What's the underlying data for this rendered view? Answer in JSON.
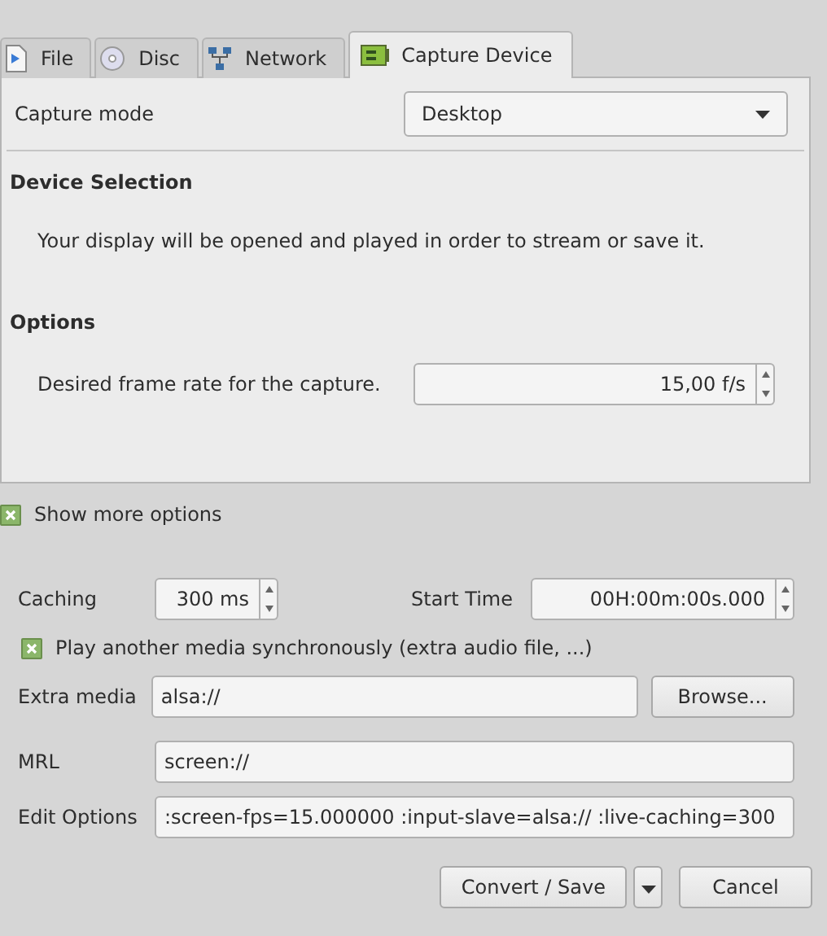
{
  "tabs": [
    {
      "label": "File",
      "selected": false
    },
    {
      "label": "Disc",
      "selected": false
    },
    {
      "label": "Network",
      "selected": false
    },
    {
      "label": "Capture Device",
      "selected": true
    }
  ],
  "capture_mode": {
    "label": "Capture mode",
    "value": "Desktop"
  },
  "device_selection": {
    "heading": "Device Selection",
    "text": "Your display will be opened and played in order to stream or save it."
  },
  "options": {
    "heading": "Options",
    "frame_rate_label": "Desired frame rate for the capture.",
    "frame_rate_value": "15,00 f/s"
  },
  "show_more_options": {
    "label": "Show more options",
    "checked": true
  },
  "caching": {
    "label": "Caching",
    "value": "300 ms"
  },
  "start_time": {
    "label": "Start Time",
    "value": "00H:00m:00s.000"
  },
  "play_another": {
    "label": "Play another media synchronously (extra audio file, ...)",
    "checked": true
  },
  "extra_media": {
    "label": "Extra media",
    "value": "alsa://",
    "button": "Browse..."
  },
  "mrl": {
    "label": "MRL",
    "value": "screen://"
  },
  "edit_options": {
    "label": "Edit Options",
    "value": ":screen-fps=15.000000 :input-slave=alsa:// :live-caching=300"
  },
  "buttons": {
    "primary": "Convert / Save",
    "cancel": "Cancel"
  }
}
